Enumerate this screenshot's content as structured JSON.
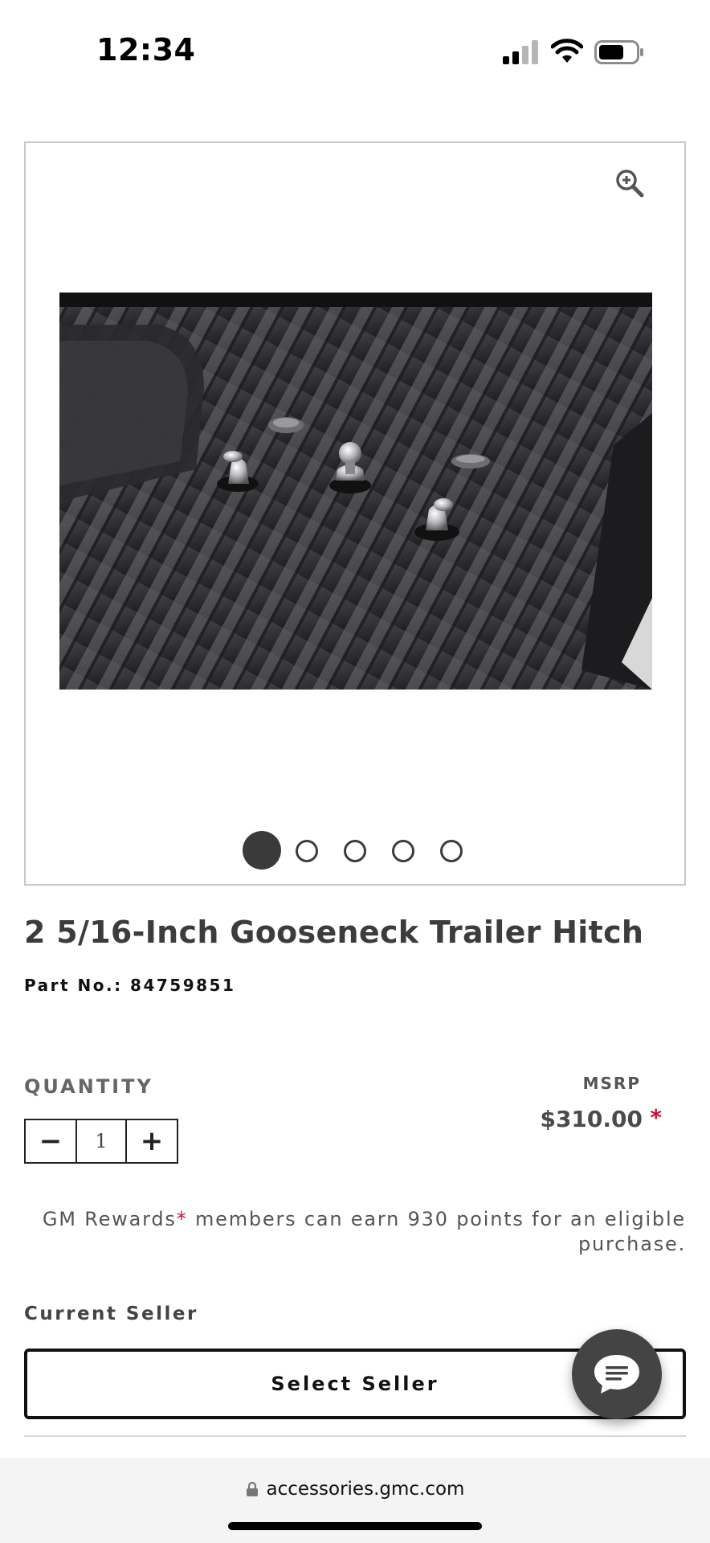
{
  "status_bar": {
    "time": "12:34",
    "signal_icon": "cellular-signal-icon",
    "wifi_icon": "wifi-icon",
    "battery_icon": "battery-icon",
    "battery_level": 0.55
  },
  "gallery": {
    "zoom_icon": "zoom-in-icon",
    "image_alt": "2 5/16-Inch Gooseneck Trailer Hitch",
    "dots_total": 5,
    "active_index": 0
  },
  "product": {
    "title": "2 5/16-Inch Gooseneck Trailer Hitch",
    "part_number": "Part No.: 84759851"
  },
  "quantity": {
    "label": "QUANTITY",
    "minus": "−",
    "value": "1",
    "plus": "+"
  },
  "price": {
    "label": "MSRP",
    "value": "$310.00",
    "asterisk": "*"
  },
  "rewards": {
    "prefix": "GM Rewards",
    "star": "*",
    "suffix": " members can earn 930 points for an eligible purchase."
  },
  "seller": {
    "label": "Current Seller",
    "button": "Select Seller"
  },
  "chat": {
    "icon": "chat-bubble-icon"
  },
  "browser": {
    "lock_icon": "lock-icon",
    "url": "accessories.gmc.com"
  },
  "colors": {
    "accent_red": "#c8102e",
    "text_dark": "#3c3c3c",
    "chat_bg": "#444444"
  }
}
